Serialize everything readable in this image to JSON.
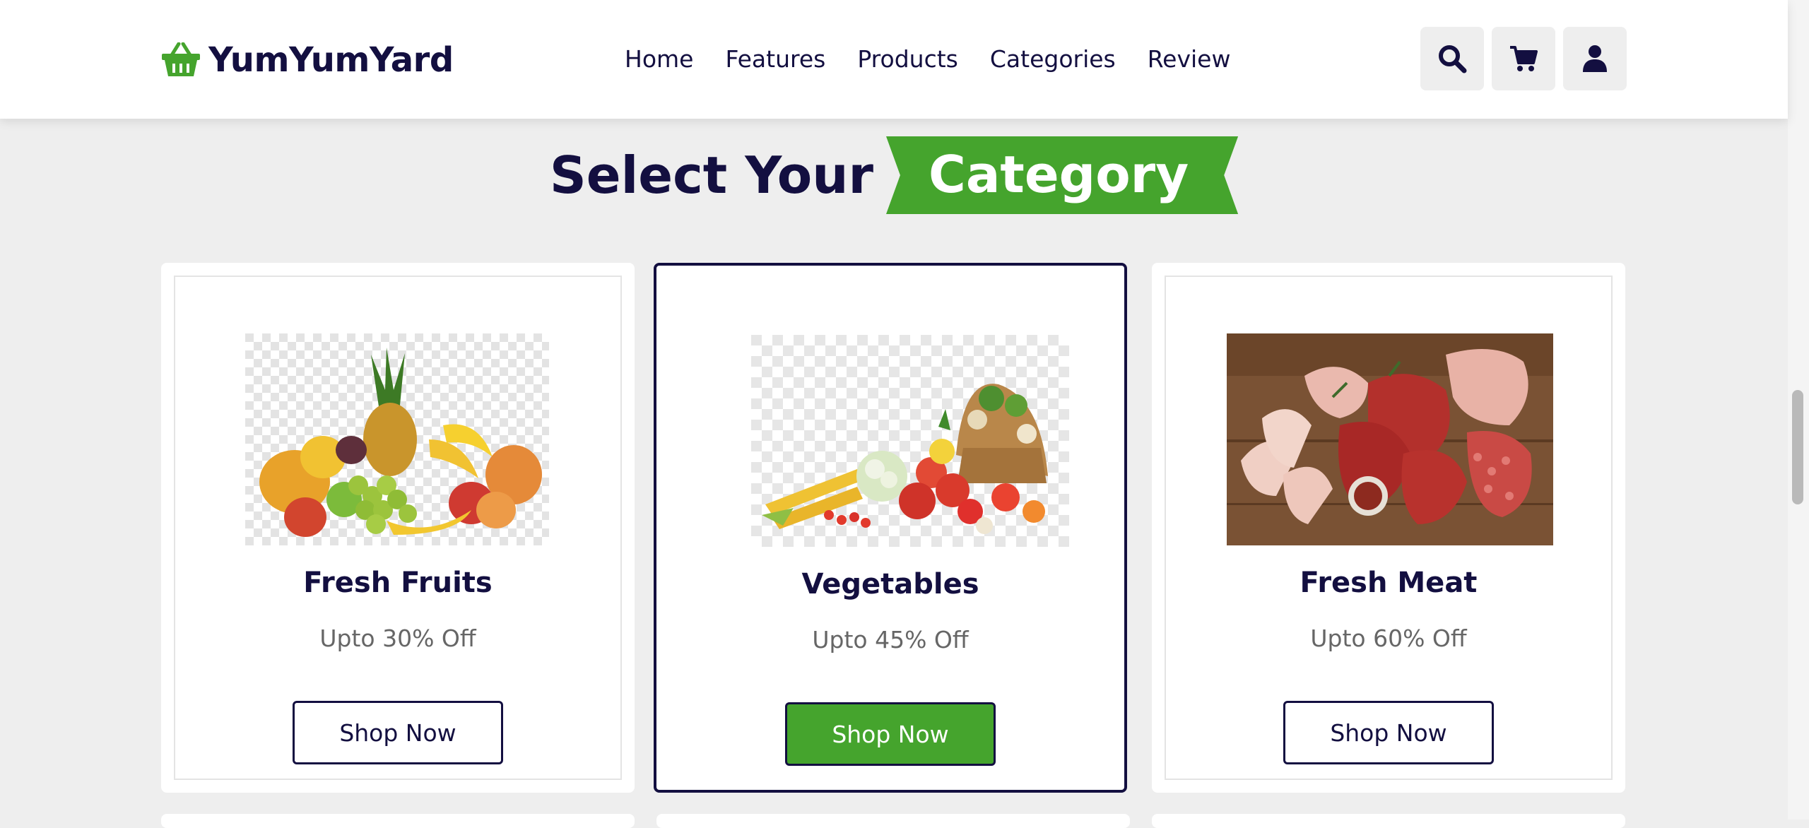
{
  "brand": {
    "name": "YumYumYard",
    "icon": "basket-icon",
    "accent": "#45a42d",
    "primary": "#130f40"
  },
  "nav": [
    {
      "label": "Home"
    },
    {
      "label": "Features"
    },
    {
      "label": "Products"
    },
    {
      "label": "Categories"
    },
    {
      "label": "Review"
    }
  ],
  "header_icons": [
    "search-icon",
    "cart-icon",
    "user-icon"
  ],
  "section": {
    "heading_plain": "Select Your",
    "heading_highlight": "Category"
  },
  "categories": [
    {
      "title": "Fresh Fruits",
      "discount": "Upto 30% Off",
      "button": "Shop Now",
      "image": "fruits-image"
    },
    {
      "title": "Vegetables",
      "discount": "Upto 45% Off",
      "button": "Shop Now",
      "image": "vegetables-image",
      "active": true
    },
    {
      "title": "Fresh Meat",
      "discount": "Upto 60% Off",
      "button": "Shop Now",
      "image": "meat-image"
    }
  ]
}
